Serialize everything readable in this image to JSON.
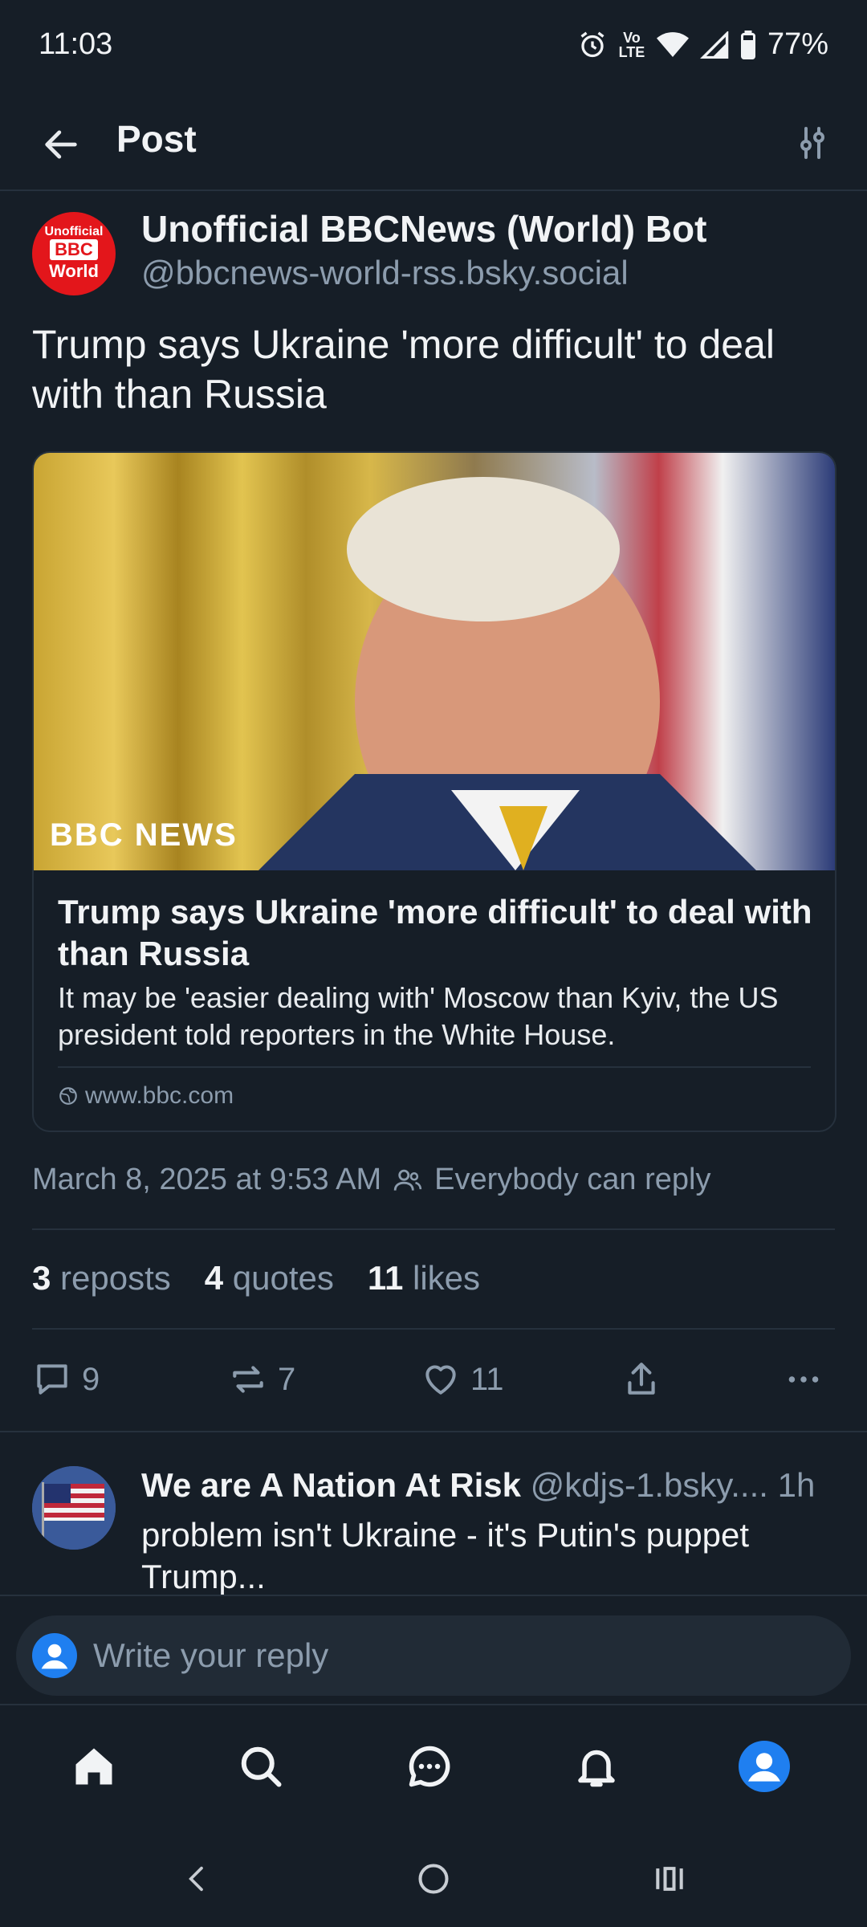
{
  "status_bar": {
    "time": "11:03",
    "network": "Vo LTE",
    "battery": "77%",
    "icons": [
      "alarm-icon",
      "volte-icon",
      "wifi-icon",
      "signal-icon",
      "battery-icon"
    ]
  },
  "header": {
    "title": "Post",
    "back_icon": "arrow-left-icon",
    "filter_icon": "sliders-icon"
  },
  "post": {
    "avatar": {
      "line1": "Unofficial",
      "line2": "BBC",
      "line3": "World"
    },
    "author_name": "Unofficial BBCNews (World) Bot",
    "author_handle": "@bbcnews-world-rss.bsky.social",
    "text": "Trump says Ukraine 'more difficult' to deal with than Russia",
    "card": {
      "image_logo": "BBC NEWS",
      "title": "Trump says Ukraine 'more difficult' to deal with than Russia",
      "description": "It may be 'easier dealing with' Moscow than Kyiv, the US president told reporters in the White House.",
      "url": "www.bbc.com"
    },
    "timestamp": "March 8, 2025 at 9:53 AM",
    "reply_setting": "Everybody can reply",
    "stats": {
      "reposts_count": "3",
      "reposts_label": "reposts",
      "quotes_count": "4",
      "quotes_label": "quotes",
      "likes_count": "11",
      "likes_label": "likes"
    },
    "actions": {
      "replies": "9",
      "reposts": "7",
      "likes": "11"
    }
  },
  "reply": {
    "author_name": "We are A Nation At Risk",
    "author_handle": "@kdjs-1.bsky....",
    "time": "1h",
    "text": "problem isn't Ukraine - it's Putin's puppet Trump..."
  },
  "composer": {
    "placeholder": "Write your reply"
  },
  "colors": {
    "background": "#161e27",
    "accent": "#1f7ff0",
    "muted_text": "#8c9cad",
    "bbc_red": "#e3161b"
  }
}
